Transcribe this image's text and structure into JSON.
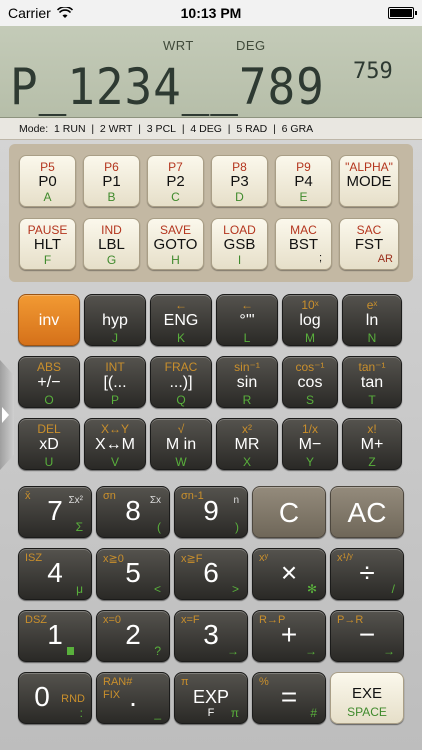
{
  "status": {
    "carrier": "Carrier",
    "time": "10:13 PM"
  },
  "display": {
    "wrt": "WRT",
    "deg": "DEG",
    "main": "P_1234__789",
    "step": "759"
  },
  "modes": [
    "Mode:  1 RUN",
    "  |  2 WRT",
    "  |  3 PCL",
    "  |  4 DEG",
    "  |  5 RAD",
    "  |  6 GRA"
  ],
  "program_keys": [
    {
      "top": "P5",
      "main": "P0",
      "bottom": "A"
    },
    {
      "top": "P6",
      "main": "P1",
      "bottom": "B"
    },
    {
      "top": "P7",
      "main": "P2",
      "bottom": "C"
    },
    {
      "top": "P8",
      "main": "P3",
      "bottom": "D"
    },
    {
      "top": "P9",
      "main": "P4",
      "bottom": "E"
    },
    {
      "top": "\"ALPHA\"",
      "main": "MODE",
      "bottom": ""
    },
    {
      "top": "PAUSE",
      "main": "HLT",
      "bottom": "F"
    },
    {
      "top": "IND",
      "main": "LBL",
      "bottom": "G"
    },
    {
      "top": "SAVE",
      "main": "GOTO",
      "bottom": "H"
    },
    {
      "top": "LOAD",
      "main": "GSB",
      "bottom": "I"
    },
    {
      "top": "MAC",
      "main": "BST",
      "bottom": "",
      "side": ";"
    },
    {
      "top": "SAC",
      "main": "FST",
      "bottom": "",
      "side": "AR"
    }
  ],
  "func_keys": [
    {
      "top": "",
      "main": "inv",
      "bottom": ""
    },
    {
      "top": "",
      "main": "hyp",
      "bottom": "J"
    },
    {
      "top": "←",
      "main": "ENG",
      "bottom": "K"
    },
    {
      "top": "←",
      "main": "°'\"",
      "bottom": "L"
    },
    {
      "top": "10ˣ",
      "main": "log",
      "bottom": "M"
    },
    {
      "top": "eˣ",
      "main": "ln",
      "bottom": "N"
    },
    {
      "top": "ABS",
      "main": "+/−",
      "bottom": "O"
    },
    {
      "top": "INT",
      "main": "[(...",
      "bottom": "P"
    },
    {
      "top": "FRAC",
      "main": "...)]",
      "bottom": "Q"
    },
    {
      "top": "sin⁻¹",
      "main": "sin",
      "bottom": "R"
    },
    {
      "top": "cos⁻¹",
      "main": "cos",
      "bottom": "S"
    },
    {
      "top": "tan⁻¹",
      "main": "tan",
      "bottom": "T"
    },
    {
      "top": "DEL",
      "main": "xD",
      "bottom": "U"
    },
    {
      "top": "X↔Y",
      "main": "X↔M",
      "bottom": "V"
    },
    {
      "top": "√",
      "main": "M in",
      "bottom": "W"
    },
    {
      "top": "x²",
      "main": "MR",
      "bottom": "X"
    },
    {
      "top": "1/x",
      "main": "M−",
      "bottom": "Y"
    },
    {
      "top": "x!",
      "main": "M+",
      "bottom": "Z"
    }
  ],
  "num_keys": [
    {
      "tl": "x̄",
      "tr": "Σx²",
      "main": "7",
      "bl": "Σ"
    },
    {
      "tl": "σn",
      "tr": "Σx",
      "main": "8",
      "bl": "("
    },
    {
      "tl": "σn-1",
      "tr": "n",
      "main": "9",
      "bl": ")"
    },
    {
      "main": "C"
    },
    {
      "main": "AC"
    },
    {
      "tl": "ISZ",
      "main": "4",
      "bl": "μ"
    },
    {
      "tl": "x≧0",
      "main": "5",
      "bl": "<"
    },
    {
      "tl": "x≧F",
      "main": "6",
      "bl": ">"
    },
    {
      "tl": "xʸ",
      "main": "×",
      "bl": "✻"
    },
    {
      "tl": "x¹/ʸ",
      "main": "÷",
      "bl": "/"
    },
    {
      "tl": "DSZ",
      "main": "1",
      "bl": ""
    },
    {
      "tl": "x=0",
      "main": "2",
      "bl": "?"
    },
    {
      "tl": "x=F",
      "main": "3",
      "bl": "→"
    },
    {
      "tl": "R→P",
      "main": "+",
      "bl": "→"
    },
    {
      "tl": "P→R",
      "main": "−",
      "bl": "→"
    },
    {
      "tl": "",
      "main": "0",
      "bl": ":",
      "side": "RND"
    },
    {
      "tl": "RAN#",
      "main": ".",
      "bl": "_",
      "side": "FIX"
    },
    {
      "tl": "π",
      "main": "EXP",
      "bl": "π",
      "side": "F"
    },
    {
      "tl": "%",
      "main": "=",
      "bl": "#"
    },
    {
      "main": "EXE",
      "bl": "SPACE"
    }
  ]
}
